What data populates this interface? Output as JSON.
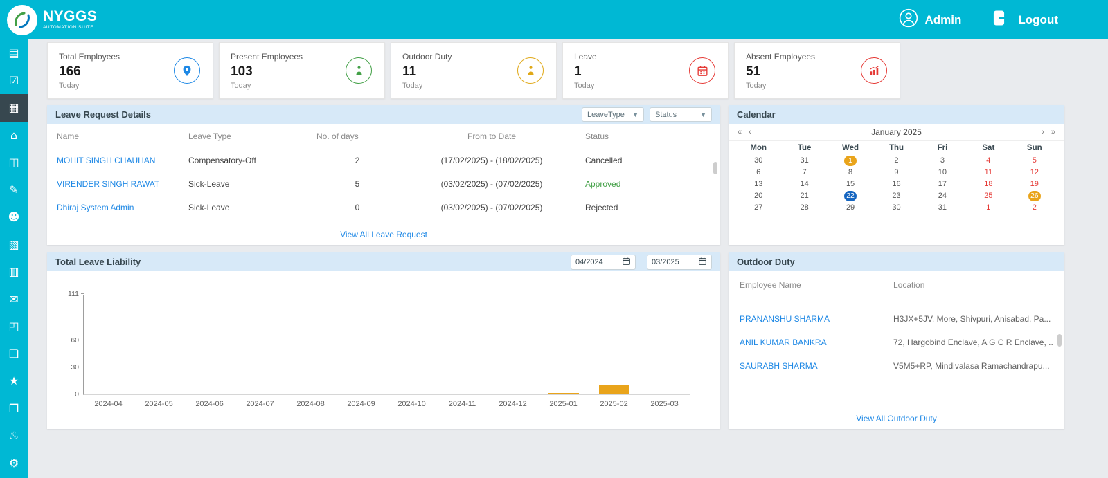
{
  "theme": {
    "accent": "#00b8d4",
    "link_blue": "#1e88e5",
    "approved_green": "#43a047",
    "weekend_red": "#e53935",
    "highlight_amber": "#e9a41b",
    "highlight_blue": "#1565c0",
    "panel_header_blue": "#d7e9f8"
  },
  "header": {
    "brand": {
      "name": "NYGGS",
      "subtitle": "AUTOMATION SUITE"
    },
    "admin_label": "Admin",
    "logout_label": "Logout"
  },
  "sidebar": {
    "items": [
      {
        "name": "attendance-icon",
        "glyph": "▤",
        "active": false
      },
      {
        "name": "approvals-icon",
        "glyph": "☑",
        "active": false
      },
      {
        "name": "dashboard-icon",
        "glyph": "▦",
        "active": true
      },
      {
        "name": "organization-icon",
        "glyph": "⌂",
        "active": false
      },
      {
        "name": "reports-icon",
        "glyph": "◫",
        "active": false
      },
      {
        "name": "requests-icon",
        "glyph": "✎",
        "active": false
      },
      {
        "name": "employees-icon",
        "glyph": "☻",
        "active": false
      },
      {
        "name": "events-calendar-icon",
        "glyph": "▧",
        "active": false
      },
      {
        "name": "analytics-icon",
        "glyph": "▥",
        "active": false
      },
      {
        "name": "mail-icon",
        "glyph": "✉",
        "active": false
      },
      {
        "name": "assets-icon",
        "glyph": "◰",
        "active": false
      },
      {
        "name": "payroll-icon",
        "glyph": "❏",
        "active": false
      },
      {
        "name": "favorites-icon",
        "glyph": "★",
        "active": false
      },
      {
        "name": "library-icon",
        "glyph": "❐",
        "active": false
      },
      {
        "name": "ideas-icon",
        "glyph": "♨",
        "active": false
      },
      {
        "name": "settings-icon",
        "glyph": "⚙",
        "active": false
      }
    ]
  },
  "stats": [
    {
      "label": "Total Employees",
      "value": "166",
      "period": "Today",
      "icon": "location-pin-icon",
      "color": "#1e88e5"
    },
    {
      "label": "Present Employees",
      "value": "103",
      "period": "Today",
      "icon": "present-person-icon",
      "color": "#43a047"
    },
    {
      "label": "Outdoor Duty",
      "value": "11",
      "period": "Today",
      "icon": "outdoor-person-icon",
      "color": "#e0a817"
    },
    {
      "label": "Leave",
      "value": "1",
      "period": "Today",
      "icon": "leave-calendar-icon",
      "color": "#e53935"
    },
    {
      "label": "Absent Employees",
      "value": "51",
      "period": "Today",
      "icon": "absent-chart-icon",
      "color": "#e53935"
    }
  ],
  "leave_requests": {
    "title": "Leave Request Details",
    "filters": [
      {
        "label": "LeaveType"
      },
      {
        "label": "Status"
      }
    ],
    "columns": [
      "Name",
      "Leave Type",
      "No. of days",
      "From to Date",
      "Status"
    ],
    "rows": [
      {
        "name": "MOHIT SINGH CHAUHAN",
        "leave_type": "Compensatory-Off",
        "days": "2",
        "from_to": "(17/02/2025) - (18/02/2025)",
        "status": "Cancelled",
        "status_type": "cancelled"
      },
      {
        "name": "VIRENDER SINGH RAWAT",
        "leave_type": "Sick-Leave",
        "days": "5",
        "from_to": "(03/02/2025) - (07/02/2025)",
        "status": "Approved",
        "status_type": "approved"
      },
      {
        "name": "Dhiraj System Admin",
        "leave_type": "Sick-Leave",
        "days": "0",
        "from_to": "(03/02/2025) - (07/02/2025)",
        "status": "Rejected",
        "status_type": "rejected"
      }
    ],
    "view_all": "View All Leave Request"
  },
  "calendar": {
    "title": "Calendar",
    "month_label": "January 2025",
    "nav_first": "«",
    "nav_prev": "‹",
    "nav_next": "›",
    "nav_last": "»",
    "weekdays": [
      "Mon",
      "Tue",
      "Wed",
      "Thu",
      "Fri",
      "Sat",
      "Sun"
    ],
    "weeks": [
      [
        {
          "d": "30"
        },
        {
          "d": "31"
        },
        {
          "d": "1",
          "hl": "amber"
        },
        {
          "d": "2"
        },
        {
          "d": "3"
        },
        {
          "d": "4",
          "wk": true
        },
        {
          "d": "5",
          "wk": true
        }
      ],
      [
        {
          "d": "6"
        },
        {
          "d": "7"
        },
        {
          "d": "8"
        },
        {
          "d": "9"
        },
        {
          "d": "10"
        },
        {
          "d": "11",
          "wk": true
        },
        {
          "d": "12",
          "wk": true
        }
      ],
      [
        {
          "d": "13"
        },
        {
          "d": "14"
        },
        {
          "d": "15"
        },
        {
          "d": "16"
        },
        {
          "d": "17"
        },
        {
          "d": "18",
          "wk": true
        },
        {
          "d": "19",
          "wk": true
        }
      ],
      [
        {
          "d": "20"
        },
        {
          "d": "21"
        },
        {
          "d": "22",
          "hl": "blue"
        },
        {
          "d": "23"
        },
        {
          "d": "24"
        },
        {
          "d": "25",
          "wk": true
        },
        {
          "d": "26",
          "hl": "amber"
        }
      ],
      [
        {
          "d": "27"
        },
        {
          "d": "28"
        },
        {
          "d": "29"
        },
        {
          "d": "30"
        },
        {
          "d": "31"
        },
        {
          "d": "1",
          "wk": true
        },
        {
          "d": "2",
          "wk": true
        }
      ]
    ]
  },
  "leave_liability": {
    "title": "Total Leave Liability",
    "date_from": "04/2024",
    "date_to": "03/2025"
  },
  "chart_data": {
    "type": "bar",
    "title": "Total Leave Liability",
    "categories": [
      "2024-04",
      "2024-05",
      "2024-06",
      "2024-07",
      "2024-08",
      "2024-09",
      "2024-10",
      "2024-11",
      "2024-12",
      "2025-01",
      "2025-02",
      "2025-03"
    ],
    "values": [
      0,
      0,
      0,
      0,
      0,
      0,
      0,
      0,
      0,
      1,
      10,
      0
    ],
    "xlabel": "",
    "ylabel": "",
    "ylim": [
      0,
      111
    ],
    "yticks": [
      0,
      30,
      60,
      111
    ],
    "bar_color": "#e9a41b",
    "grid": false,
    "legend": false
  },
  "outdoor_duty": {
    "title": "Outdoor Duty",
    "columns": [
      "Employee Name",
      "Location"
    ],
    "rows": [
      {
        "name": "PRANANSHU SHARMA",
        "location": "H3JX+5JV, More, Shivpuri, Anisabad, Pa..."
      },
      {
        "name": "ANIL KUMAR BANKRA",
        "location": "72, Hargobind Enclave, A G C R Enclave, ..."
      },
      {
        "name": "SAURABH SHARMA",
        "location": "V5M5+RP, Mindivalasa Ramachandrapu..."
      }
    ],
    "view_all": "View All Outdoor Duty"
  }
}
